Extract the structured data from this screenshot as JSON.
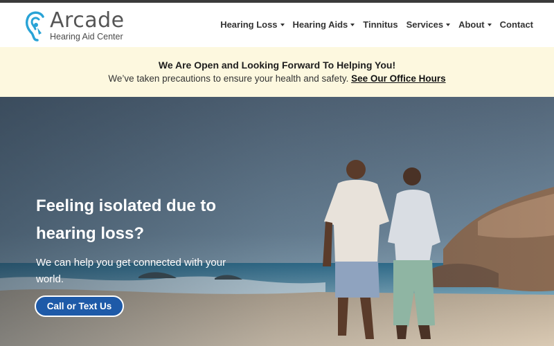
{
  "brand": {
    "name": "Arcade",
    "tagline": "Hearing Aid Center",
    "accent": "#29a3d6"
  },
  "nav": {
    "items": [
      {
        "label": "Hearing Loss",
        "dropdown": true
      },
      {
        "label": "Hearing Aids",
        "dropdown": true
      },
      {
        "label": "Tinnitus",
        "dropdown": false
      },
      {
        "label": "Services",
        "dropdown": true
      },
      {
        "label": "About",
        "dropdown": true
      },
      {
        "label": "Contact",
        "dropdown": false
      }
    ]
  },
  "banner": {
    "heading": "We Are Open and Looking Forward To Helping You!",
    "text": "We’ve taken precautions to ensure your health and safety.",
    "link_label": "See Our Office Hours",
    "background": "#fdf8df"
  },
  "hero": {
    "heading": "Feeling isolated due to hearing loss?",
    "subtext": "We can help you get connected with your world.",
    "cta_label": "Call or Text Us",
    "cta_color": "#1e5aa8"
  }
}
